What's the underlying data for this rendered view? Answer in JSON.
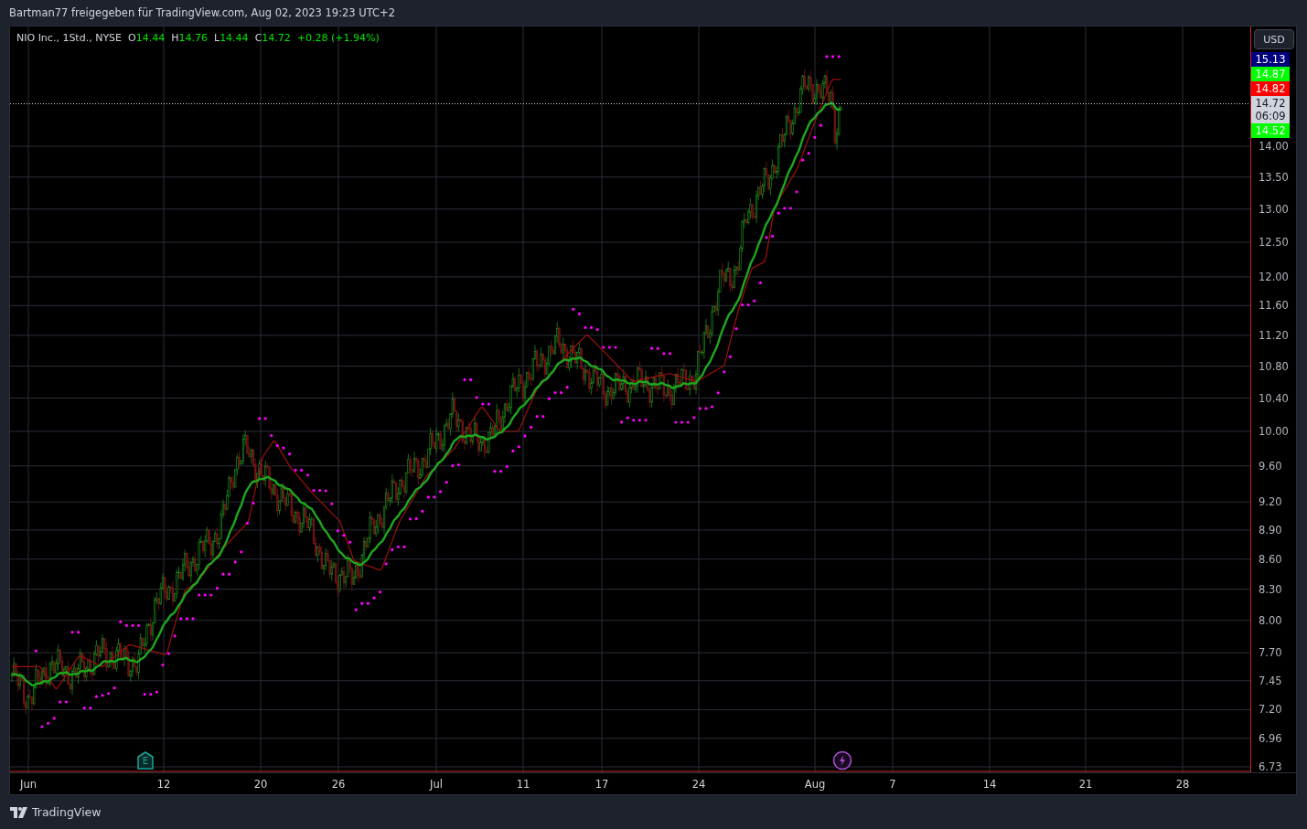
{
  "header": {
    "text": "Bartman77 freigegeben für TradingView.com, Aug 02, 2023 19:23 UTC+2"
  },
  "legend": {
    "symbol": "NIO Inc., 1Std., NYSE",
    "values": [
      {
        "label": "O",
        "value": "14.44"
      },
      {
        "label": "H",
        "value": "14.76"
      },
      {
        "label": "L",
        "value": "14.44"
      },
      {
        "label": "C",
        "value": "14.72"
      }
    ],
    "change": "+0.28 (+1.94%)"
  },
  "currency_button": "USD",
  "price_tags": [
    {
      "value": "15.13",
      "color": "#000080"
    },
    {
      "value": "14.87",
      "color": "#00ff00"
    },
    {
      "value": "14.82",
      "color": "#ff0000"
    },
    {
      "value": "14.72",
      "sublabel": "06:09",
      "color": "#d1d4dc"
    },
    {
      "value": "14.52",
      "color": "#00ff00"
    }
  ],
  "price_axis": [
    "14.00",
    "13.50",
    "13.00",
    "12.50",
    "12.00",
    "11.60",
    "11.20",
    "10.80",
    "10.40",
    "10.00",
    "9.60",
    "9.20",
    "8.90",
    "8.60",
    "8.30",
    "8.00",
    "7.70",
    "7.45",
    "7.20",
    "6.96",
    "6.73"
  ],
  "time_axis": [
    "Jun",
    "12",
    "20",
    "26",
    "Jul",
    "11",
    "17",
    "24",
    "Aug",
    "7",
    "14",
    "21",
    "28"
  ],
  "earnings_marker": "E",
  "footer": {
    "brand": "TradingView"
  }
}
